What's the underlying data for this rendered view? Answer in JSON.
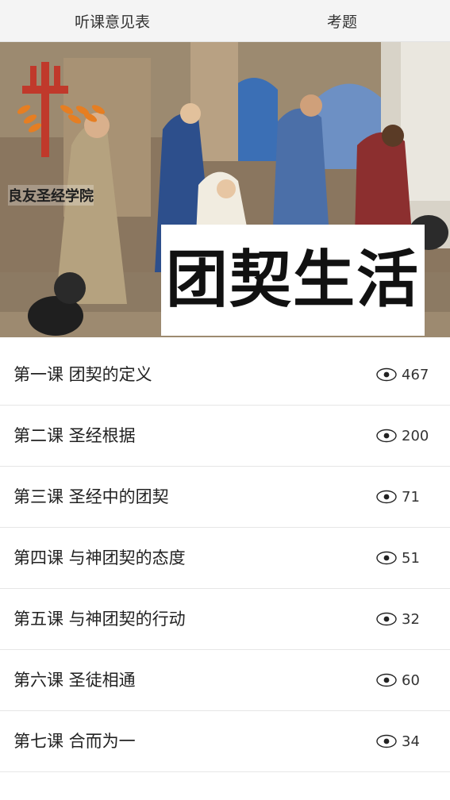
{
  "tabs": [
    {
      "label": "听课意见表"
    },
    {
      "label": "考题"
    }
  ],
  "banner": {
    "title": "团契生活",
    "logo_caption": "良友圣经学院"
  },
  "lessons": [
    {
      "title": "第一课 团契的定义",
      "views": "467"
    },
    {
      "title": "第二课 圣经根据",
      "views": "200"
    },
    {
      "title": "第三课 圣经中的团契",
      "views": "71"
    },
    {
      "title": "第四课 与神团契的态度",
      "views": "51"
    },
    {
      "title": "第五课 与神团契的行动",
      "views": "32"
    },
    {
      "title": "第六课 圣徒相通",
      "views": "60"
    },
    {
      "title": "第七课 合而为一",
      "views": "34"
    }
  ],
  "icons": {
    "view": "eye-icon",
    "logo": "cross-wheat-logo"
  },
  "colors": {
    "logo_red": "#c0392b",
    "logo_orange": "#e67e22"
  }
}
